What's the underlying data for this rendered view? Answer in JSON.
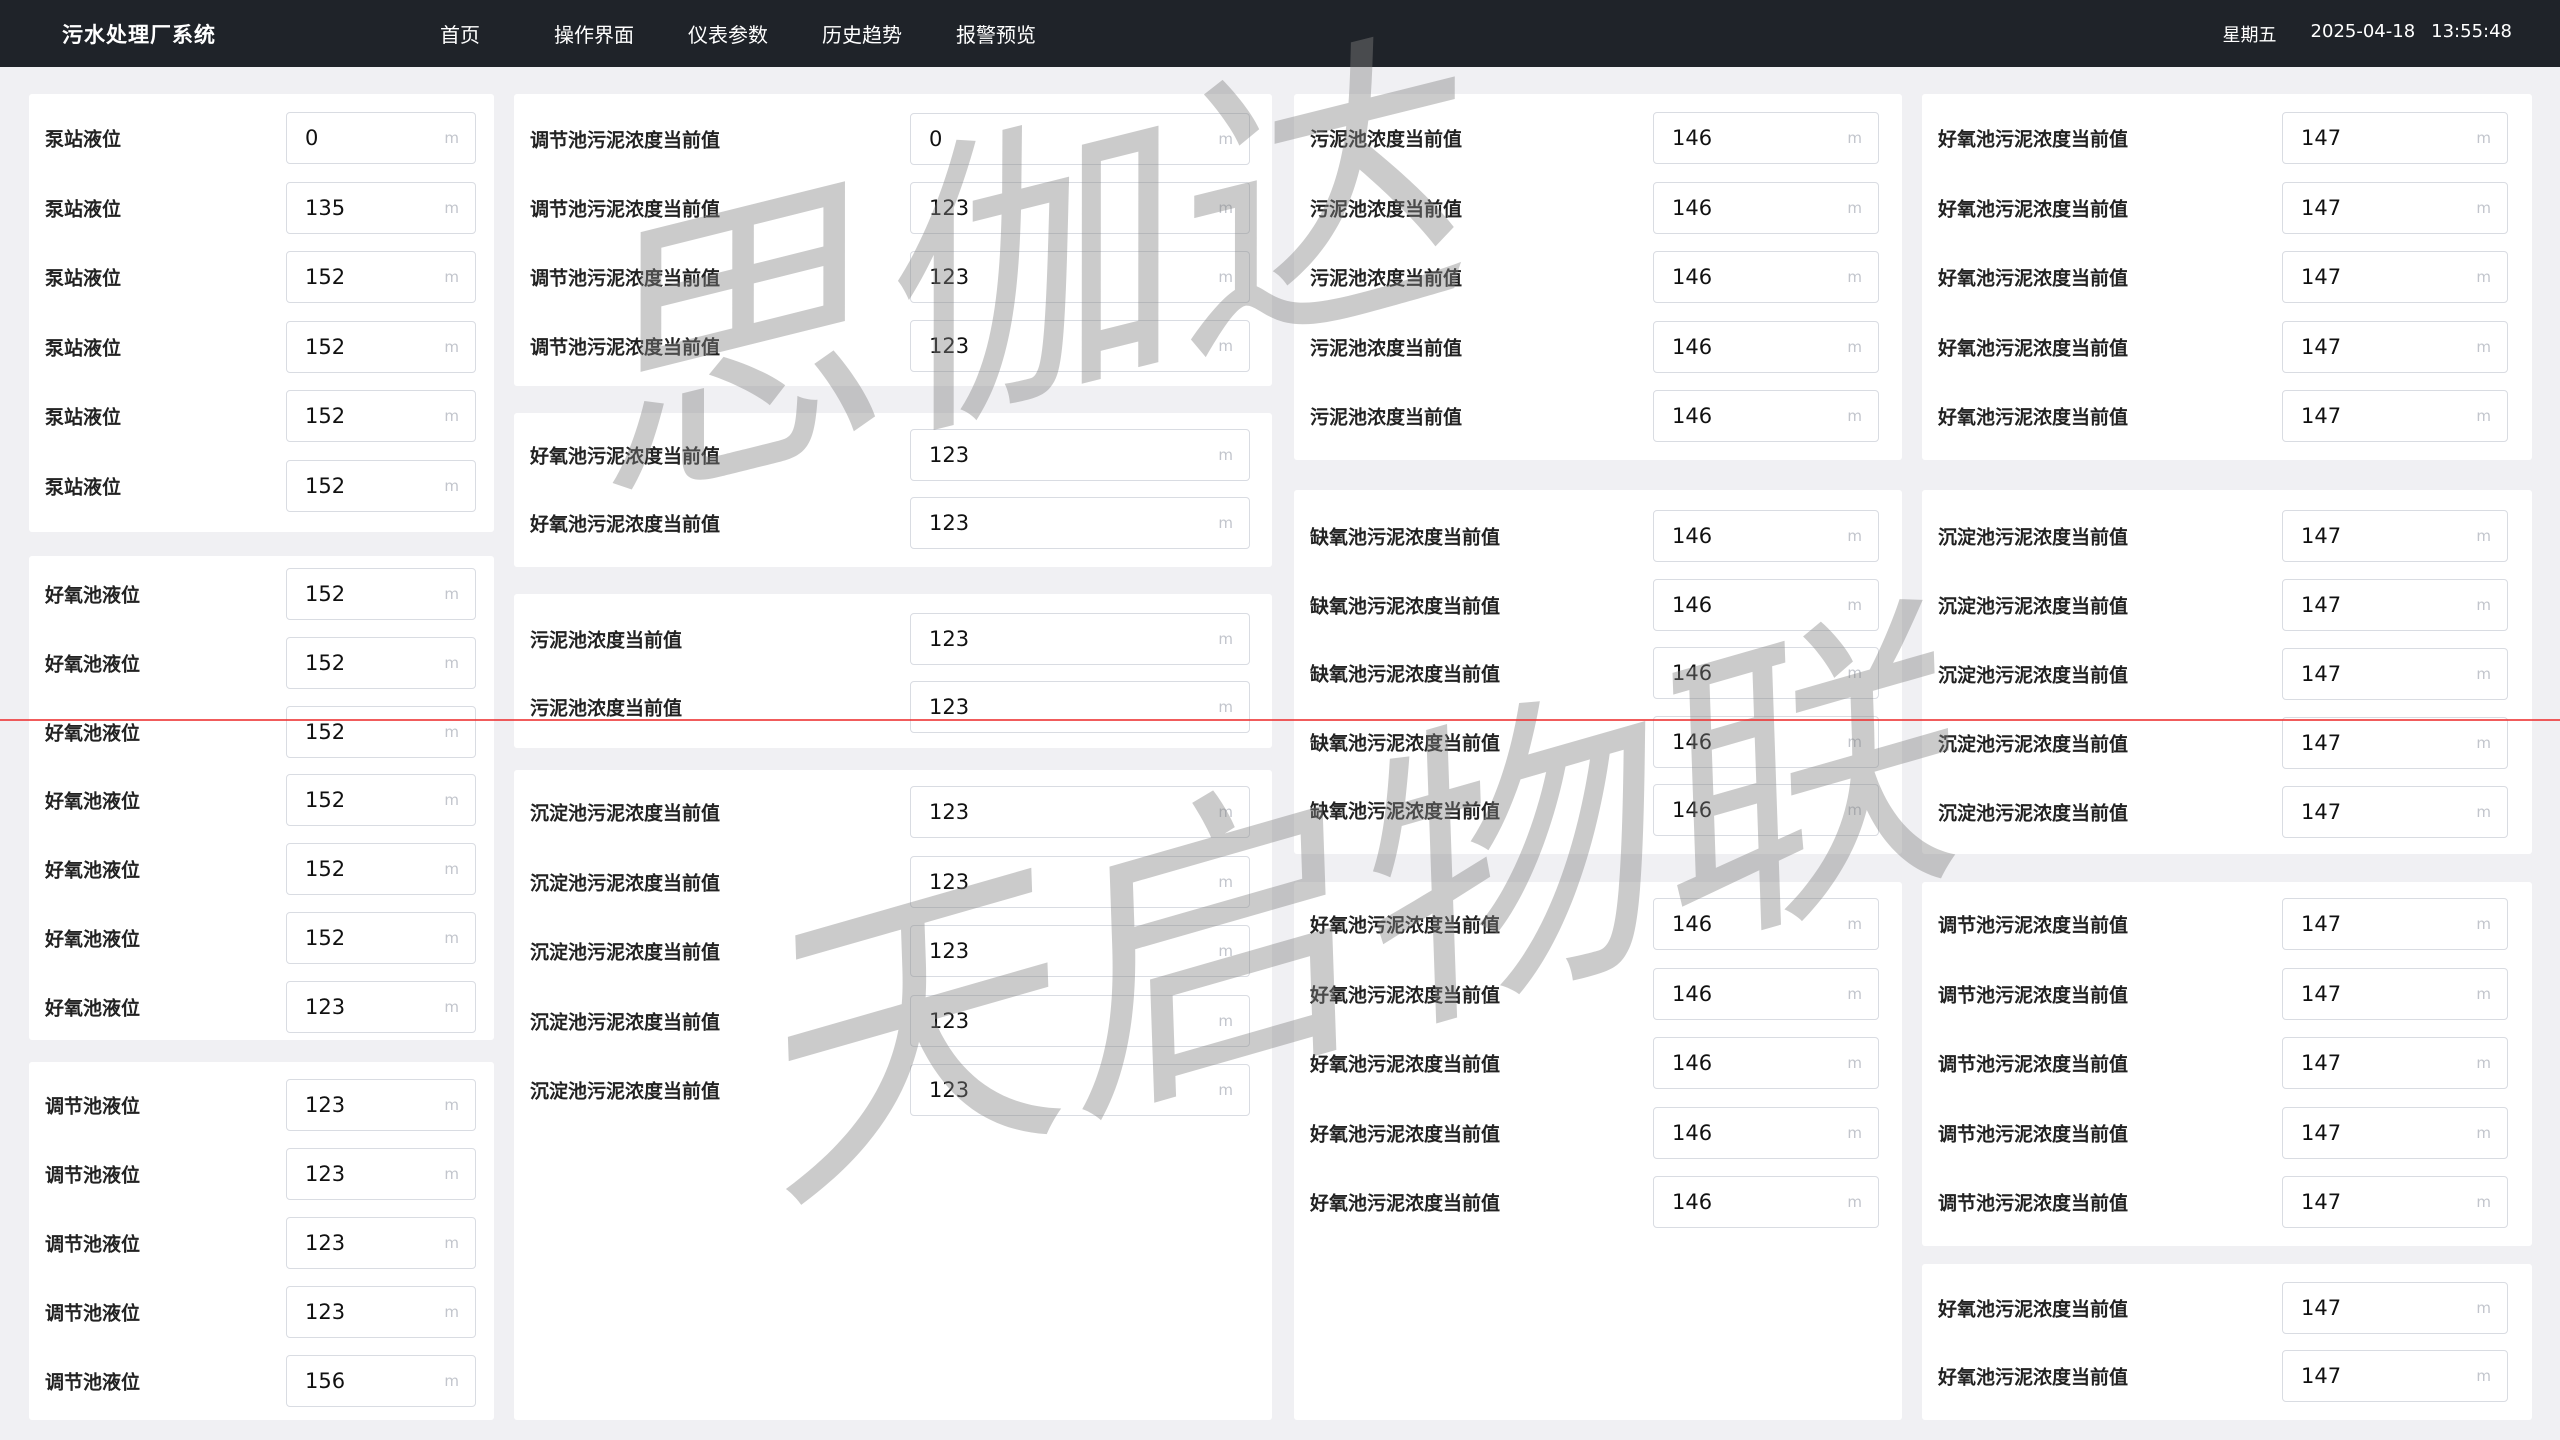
{
  "header": {
    "app_title": "污水处理厂系统",
    "nav": [
      "首页",
      "操作界面",
      "仪表参数",
      "历史趋势",
      "报警预览"
    ],
    "weekday": "星期五",
    "date": "2025-04-18",
    "time": "13:55:48"
  },
  "unit": "m",
  "watermark": {
    "line1": "思伽达",
    "line2": "天启物联"
  },
  "col1": {
    "group1": [
      {
        "label": "泵站液位",
        "value": "0"
      },
      {
        "label": "泵站液位",
        "value": "135"
      },
      {
        "label": "泵站液位",
        "value": "152"
      },
      {
        "label": "泵站液位",
        "value": "152"
      },
      {
        "label": "泵站液位",
        "value": "152"
      },
      {
        "label": "泵站液位",
        "value": "152"
      }
    ],
    "group2": [
      {
        "label": "好氧池液位",
        "value": "152"
      },
      {
        "label": "好氧池液位",
        "value": "152"
      },
      {
        "label": "好氧池液位",
        "value": "152"
      },
      {
        "label": "好氧池液位",
        "value": "152"
      },
      {
        "label": "好氧池液位",
        "value": "152"
      },
      {
        "label": "好氧池液位",
        "value": "152"
      },
      {
        "label": "好氧池液位",
        "value": "123"
      }
    ],
    "group3": [
      {
        "label": "调节池液位",
        "value": "123"
      },
      {
        "label": "调节池液位",
        "value": "123"
      },
      {
        "label": "调节池液位",
        "value": "123"
      },
      {
        "label": "调节池液位",
        "value": "123"
      },
      {
        "label": "调节池液位",
        "value": "156"
      }
    ]
  },
  "col2": {
    "group1": [
      {
        "label": "调节池污泥浓度当前值",
        "value": "0"
      },
      {
        "label": "调节池污泥浓度当前值",
        "value": "123"
      },
      {
        "label": "调节池污泥浓度当前值",
        "value": "123"
      },
      {
        "label": "调节池污泥浓度当前值",
        "value": "123"
      }
    ],
    "group2": [
      {
        "label": "好氧池污泥浓度当前值",
        "value": "123"
      },
      {
        "label": "好氧池污泥浓度当前值",
        "value": "123"
      }
    ],
    "group3": [
      {
        "label": "污泥池浓度当前值",
        "value": "123"
      },
      {
        "label": "污泥池浓度当前值",
        "value": "123"
      }
    ],
    "group4": [
      {
        "label": "沉淀池污泥浓度当前值",
        "value": "123"
      },
      {
        "label": "沉淀池污泥浓度当前值",
        "value": "123"
      },
      {
        "label": "沉淀池污泥浓度当前值",
        "value": "123"
      },
      {
        "label": "沉淀池污泥浓度当前值",
        "value": "123"
      },
      {
        "label": "沉淀池污泥浓度当前值",
        "value": "123"
      }
    ]
  },
  "col3": {
    "group1": [
      {
        "label": "污泥池浓度当前值",
        "value": "146"
      },
      {
        "label": "污泥池浓度当前值",
        "value": "146"
      },
      {
        "label": "污泥池浓度当前值",
        "value": "146"
      },
      {
        "label": "污泥池浓度当前值",
        "value": "146"
      },
      {
        "label": "污泥池浓度当前值",
        "value": "146"
      }
    ],
    "group2": [
      {
        "label": "缺氧池污泥浓度当前值",
        "value": "146"
      },
      {
        "label": "缺氧池污泥浓度当前值",
        "value": "146"
      },
      {
        "label": "缺氧池污泥浓度当前值",
        "value": "146"
      },
      {
        "label": "缺氧池污泥浓度当前值",
        "value": "146"
      },
      {
        "label": "缺氧池污泥浓度当前值",
        "value": "146"
      }
    ],
    "group3": [
      {
        "label": "好氧池污泥浓度当前值",
        "value": "146"
      },
      {
        "label": "好氧池污泥浓度当前值",
        "value": "146"
      },
      {
        "label": "好氧池污泥浓度当前值",
        "value": "146"
      },
      {
        "label": "好氧池污泥浓度当前值",
        "value": "146"
      },
      {
        "label": "好氧池污泥浓度当前值",
        "value": "146"
      }
    ]
  },
  "col4": {
    "group1": [
      {
        "label": "好氧池污泥浓度当前值",
        "value": "147"
      },
      {
        "label": "好氧池污泥浓度当前值",
        "value": "147"
      },
      {
        "label": "好氧池污泥浓度当前值",
        "value": "147"
      },
      {
        "label": "好氧池污泥浓度当前值",
        "value": "147"
      },
      {
        "label": "好氧池污泥浓度当前值",
        "value": "147"
      }
    ],
    "group2": [
      {
        "label": "沉淀池污泥浓度当前值",
        "value": "147"
      },
      {
        "label": "沉淀池污泥浓度当前值",
        "value": "147"
      },
      {
        "label": "沉淀池污泥浓度当前值",
        "value": "147"
      },
      {
        "label": "沉淀池污泥浓度当前值",
        "value": "147"
      },
      {
        "label": "沉淀池污泥浓度当前值",
        "value": "147"
      }
    ],
    "group3": [
      {
        "label": "调节池污泥浓度当前值",
        "value": "147"
      },
      {
        "label": "调节池污泥浓度当前值",
        "value": "147"
      },
      {
        "label": "调节池污泥浓度当前值",
        "value": "147"
      },
      {
        "label": "调节池污泥浓度当前值",
        "value": "147"
      },
      {
        "label": "调节池污泥浓度当前值",
        "value": "147"
      }
    ],
    "group4": [
      {
        "label": "好氧池污泥浓度当前值",
        "value": "147"
      },
      {
        "label": "好氧池污泥浓度当前值",
        "value": "147"
      }
    ]
  }
}
